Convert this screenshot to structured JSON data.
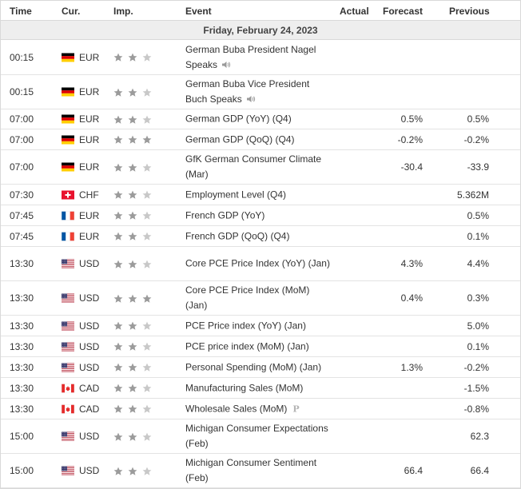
{
  "header": {
    "time": "Time",
    "currency": "Cur.",
    "importance": "Imp.",
    "event": "Event",
    "actual": "Actual",
    "forecast": "Forecast",
    "previous": "Previous"
  },
  "day_label": "Friday, February 24, 2023",
  "colors": {
    "star_filled": "#9b9b9b",
    "star_empty": "#c8c8c8",
    "border": "#d9d9d9",
    "day_bg": "#eeeeee"
  },
  "rows": [
    {
      "time": "00:15",
      "flag": "de",
      "currency": "EUR",
      "importance": 2,
      "event": "German Buba President Nagel Speaks",
      "icon": "speaker-icon",
      "actual": "",
      "forecast": "",
      "previous": ""
    },
    {
      "time": "00:15",
      "flag": "de",
      "currency": "EUR",
      "importance": 2,
      "event": "German Buba Vice President Buch Speaks",
      "icon": "speaker-icon",
      "actual": "",
      "forecast": "",
      "previous": ""
    },
    {
      "time": "07:00",
      "flag": "de",
      "currency": "EUR",
      "importance": 2,
      "event": "German GDP (YoY) (Q4)",
      "icon": "",
      "actual": "",
      "forecast": "0.5%",
      "previous": "0.5%"
    },
    {
      "time": "07:00",
      "flag": "de",
      "currency": "EUR",
      "importance": 3,
      "event": "German GDP (QoQ) (Q4)",
      "icon": "",
      "actual": "",
      "forecast": "-0.2%",
      "previous": "-0.2%"
    },
    {
      "time": "07:00",
      "flag": "de",
      "currency": "EUR",
      "importance": 2,
      "event": "GfK German Consumer Climate (Mar)",
      "icon": "",
      "actual": "",
      "forecast": "-30.4",
      "previous": "-33.9"
    },
    {
      "time": "07:30",
      "flag": "ch",
      "currency": "CHF",
      "importance": 2,
      "event": "Employment Level (Q4)",
      "icon": "",
      "actual": "",
      "forecast": "",
      "previous": "5.362M"
    },
    {
      "time": "07:45",
      "flag": "fr",
      "currency": "EUR",
      "importance": 2,
      "event": "French GDP (YoY)",
      "icon": "",
      "actual": "",
      "forecast": "",
      "previous": "0.5%"
    },
    {
      "time": "07:45",
      "flag": "fr",
      "currency": "EUR",
      "importance": 2,
      "event": "French GDP (QoQ) (Q4)",
      "icon": "",
      "actual": "",
      "forecast": "",
      "previous": "0.1%"
    },
    {
      "time": "13:30",
      "flag": "us",
      "currency": "USD",
      "importance": 2,
      "event": "Core PCE Price Index (YoY) (Jan)",
      "icon": "",
      "actual": "",
      "forecast": "4.3%",
      "previous": "4.4%"
    },
    {
      "time": "13:30",
      "flag": "us",
      "currency": "USD",
      "importance": 3,
      "event": "Core PCE Price Index (MoM) (Jan)",
      "icon": "",
      "actual": "",
      "forecast": "0.4%",
      "previous": "0.3%"
    },
    {
      "time": "13:30",
      "flag": "us",
      "currency": "USD",
      "importance": 2,
      "event": "PCE Price index (YoY) (Jan)",
      "icon": "",
      "actual": "",
      "forecast": "",
      "previous": "5.0%"
    },
    {
      "time": "13:30",
      "flag": "us",
      "currency": "USD",
      "importance": 2,
      "event": "PCE price index (MoM) (Jan)",
      "icon": "",
      "actual": "",
      "forecast": "",
      "previous": "0.1%"
    },
    {
      "time": "13:30",
      "flag": "us",
      "currency": "USD",
      "importance": 2,
      "event": "Personal Spending (MoM) (Jan)",
      "icon": "",
      "actual": "",
      "forecast": "1.3%",
      "previous": "-0.2%"
    },
    {
      "time": "13:30",
      "flag": "ca",
      "currency": "CAD",
      "importance": 2,
      "event": "Manufacturing Sales (MoM)",
      "icon": "",
      "actual": "",
      "forecast": "",
      "previous": "-1.5%"
    },
    {
      "time": "13:30",
      "flag": "ca",
      "currency": "CAD",
      "importance": 2,
      "event": "Wholesale Sales (MoM)",
      "icon": "preliminary-icon",
      "icon_text": "P",
      "actual": "",
      "forecast": "",
      "previous": "-0.8%"
    },
    {
      "time": "15:00",
      "flag": "us",
      "currency": "USD",
      "importance": 2,
      "event": "Michigan Consumer Expectations (Feb)",
      "icon": "",
      "actual": "",
      "forecast": "",
      "previous": "62.3"
    },
    {
      "time": "15:00",
      "flag": "us",
      "currency": "USD",
      "importance": 2,
      "event": "Michigan Consumer Sentiment (Feb)",
      "icon": "",
      "actual": "",
      "forecast": "66.4",
      "previous": "66.4"
    }
  ]
}
